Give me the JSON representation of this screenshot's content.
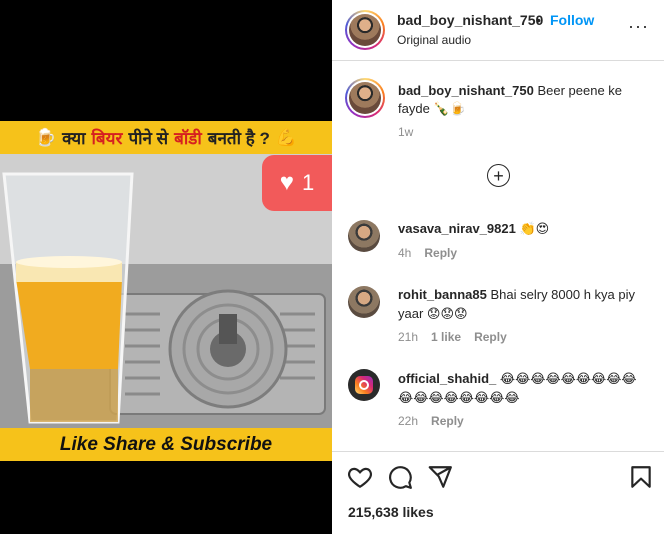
{
  "post": {
    "username": "bad_boy_nishant_750",
    "dot": "•",
    "follow_label": "Follow",
    "audio_label": "Original audio",
    "more_label": "···"
  },
  "media": {
    "banner_top_prefix": "क्या",
    "banner_top_accent1": "बियर",
    "banner_top_middle": "पीने से",
    "banner_top_accent2": "बॉडी",
    "banner_top_suffix": "बनती है ?",
    "banner_bottom": "Like Share & Subscribe",
    "like_count": "1"
  },
  "caption": {
    "username": "bad_boy_nishant_750",
    "text": "Beer peene ke fayde 🍾🍺",
    "time": "1w"
  },
  "load_more_label": "+",
  "comments": [
    {
      "username": "vasava_nirav_9821",
      "text": "👏😍",
      "time": "4h",
      "reply": "Reply",
      "likes": ""
    },
    {
      "username": "rohit_banna85",
      "text": "Bhai selry 8000 h kya piy yaar 😟😟😟",
      "time": "21h",
      "reply": "Reply",
      "likes": "1 like"
    },
    {
      "username": "official_shahid_",
      "text": "😂😂😂😂😂😂😂😂😂😂😂😂😂😂😂😂😂",
      "time": "22h",
      "reply": "Reply",
      "likes": ""
    }
  ],
  "footer": {
    "likes": "215,638 likes"
  },
  "icons": [
    "heart-icon",
    "comment-icon",
    "share-icon",
    "bookmark-icon",
    "more-icon",
    "plus-circle-icon"
  ],
  "colors": {
    "accent": "#0095f6",
    "banner": "#f6c21a",
    "badge": "#f25a5a"
  }
}
